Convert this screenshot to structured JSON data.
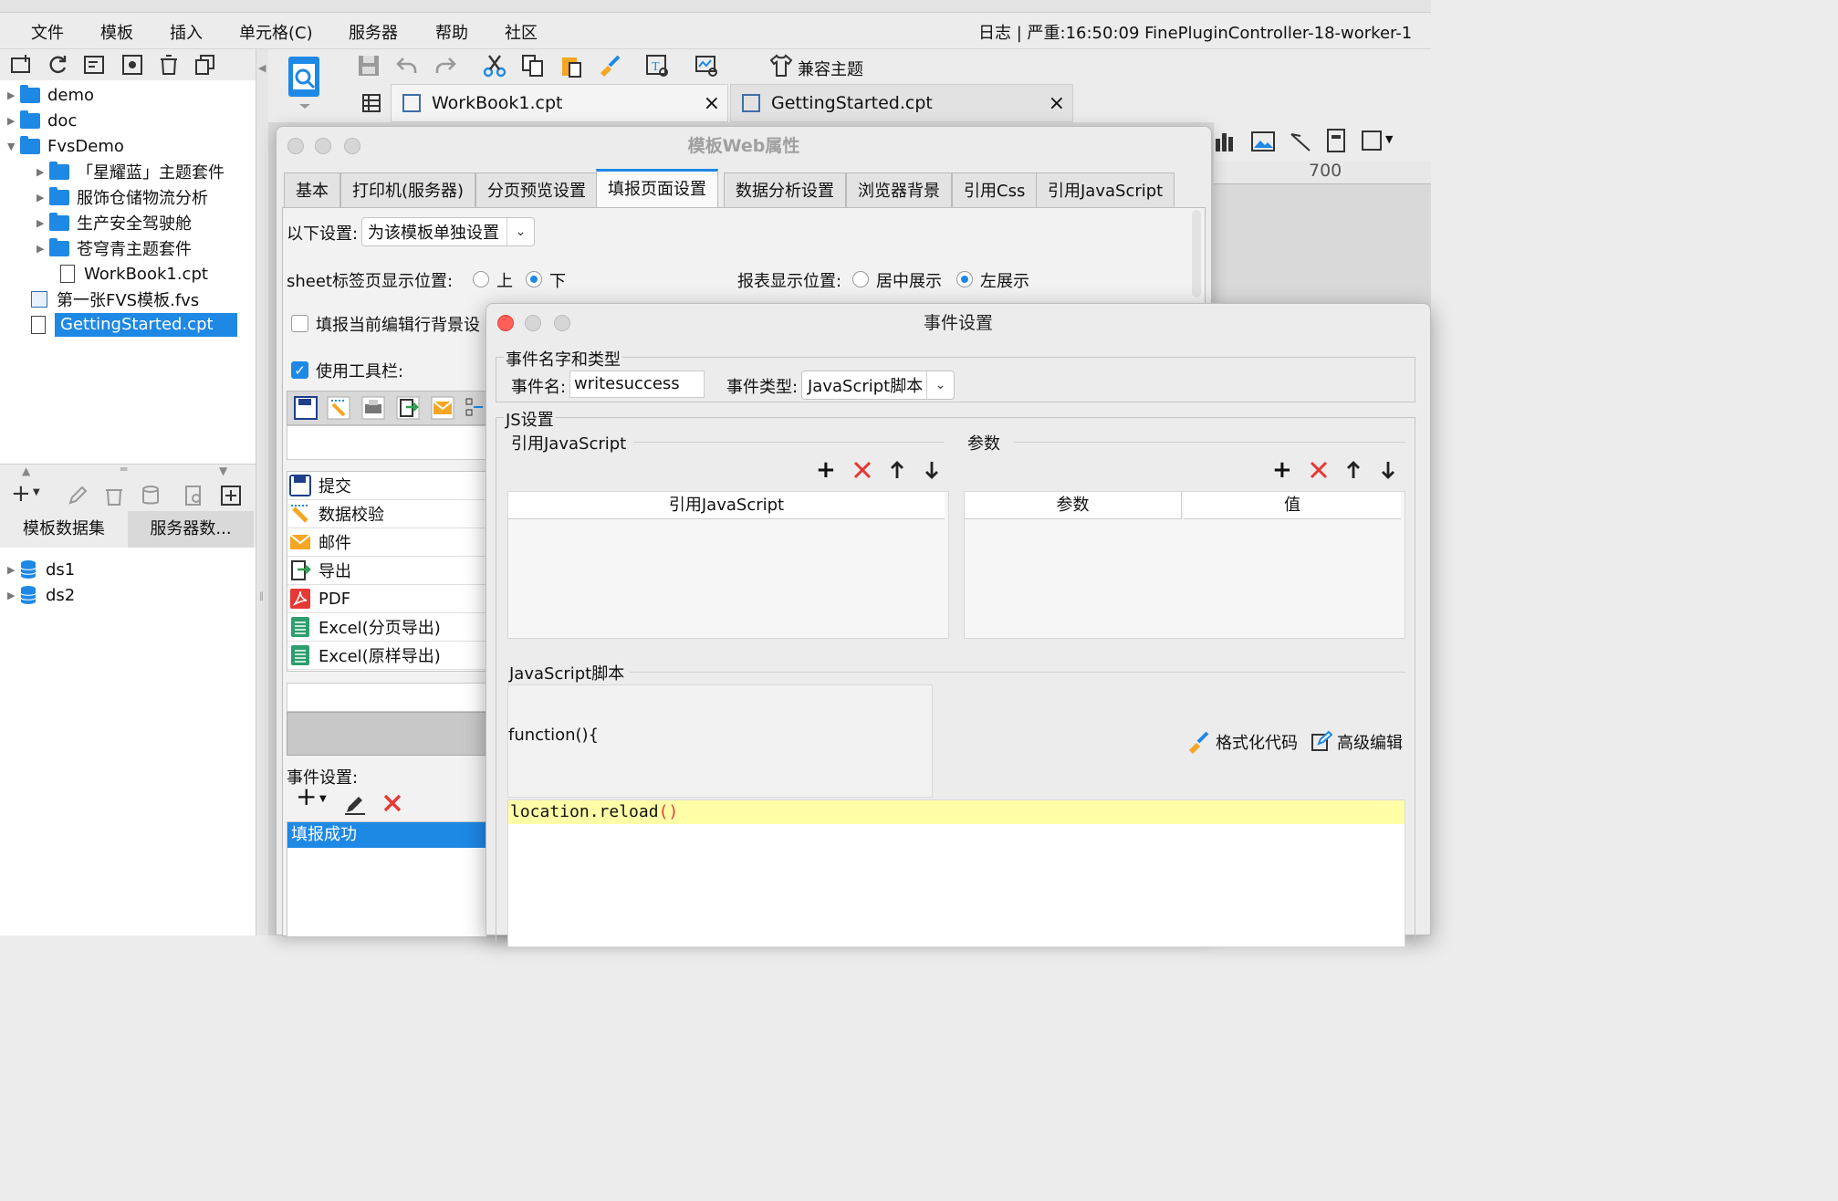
{
  "menu": {
    "items": [
      "文件",
      "模板",
      "插入",
      "单元格(C)",
      "服务器",
      "帮助",
      "社区"
    ],
    "status": "日志 | 严重:16:50:09 FinePluginController-18-worker-1"
  },
  "tree": {
    "items": [
      {
        "label": "demo"
      },
      {
        "label": "doc"
      },
      {
        "label": "FvsDemo"
      },
      {
        "label": "「星耀蓝」主题套件"
      },
      {
        "label": "服饰仓储物流分析"
      },
      {
        "label": "生产安全驾驶舱"
      },
      {
        "label": "苍穹青主题套件"
      },
      {
        "label": "WorkBook1.cpt"
      },
      {
        "label": "第一张FVS模板.fvs"
      },
      {
        "label": "GettingStarted.cpt"
      }
    ]
  },
  "datasets": {
    "tabs": [
      "模板数据集",
      "服务器数..."
    ],
    "items": [
      "ds1",
      "ds2"
    ]
  },
  "toolbar": {
    "compat_theme": "兼容主题"
  },
  "file_tabs": [
    {
      "label": "WorkBook1.cpt",
      "close": "×"
    },
    {
      "label": "GettingStarted.cpt",
      "close": "×"
    }
  ],
  "ruler": {
    "mark": "700"
  },
  "web_props": {
    "title": "模板Web属性",
    "tabs": [
      "基本",
      "打印机(服务器)",
      "分页预览设置",
      "填报页面设置",
      "数据分析设置",
      "浏览器背景",
      "引用Css",
      "引用JavaScript"
    ],
    "settings_label": "以下设置:",
    "settings_value": "为该模板单独设置",
    "sheet_pos_label": "sheet标签页显示位置:",
    "sheet_pos_top": "上",
    "sheet_pos_bottom": "下",
    "report_pos_label": "报表显示位置:",
    "report_center": "居中展示",
    "report_left": "左展示",
    "fill_row_bg": "填报当前编辑行背景设",
    "use_toolbar": "使用工具栏:",
    "toolbar_items": [
      "提交",
      "数据校验",
      "邮件",
      "导出",
      "PDF",
      "Excel(分页导出)",
      "Excel(原样导出)"
    ],
    "events_label": "事件设置:",
    "event_items": [
      "填报成功"
    ]
  },
  "event_dialog": {
    "title": "事件设置",
    "group_name_type": "事件名字和类型",
    "event_name_label": "事件名:",
    "event_name_value": "writesuccess",
    "event_type_label": "事件类型:",
    "event_type_value": "JavaScript脚本",
    "group_js": "JS设置",
    "ref_js_label": "引用JavaScript",
    "params_label": "参数",
    "ref_js_col": "引用JavaScript",
    "param_col": "参数",
    "value_col": "值",
    "script_label": "JavaScript脚本",
    "function_open": "function(){",
    "format_code": "格式化代码",
    "advanced_edit": "高级编辑",
    "code_text": "location.reload",
    "code_parens": "()"
  },
  "colors": {
    "accent": "#1e88e5",
    "delete": "#e53935",
    "code_highlight": "#ffffa8"
  }
}
